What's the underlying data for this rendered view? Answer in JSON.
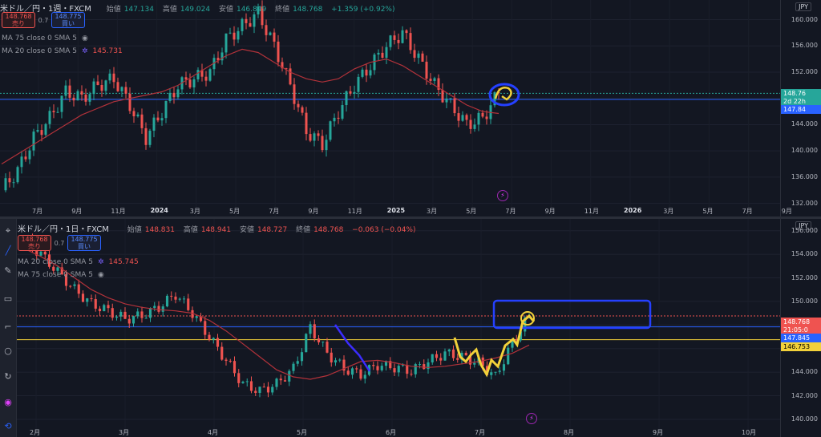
{
  "top": {
    "symbol": "米ドル／円・1週・FXCM",
    "ohlc": [
      {
        "label": "始値",
        "value": "147.134"
      },
      {
        "label": "高値",
        "value": "149.024"
      },
      {
        "label": "安値",
        "value": "146.849"
      },
      {
        "label": "終値",
        "value": "148.768"
      }
    ],
    "change": "+1.359 (+0.92%)",
    "sell_price": "148.768",
    "sell_label": "売り",
    "spread": "0.7",
    "buy_price": "148.775",
    "buy_label": "買い",
    "indicators": [
      {
        "text": "MA 75 close 0 SMA 5",
        "value": ""
      },
      {
        "text": "MA 20 close 0 SMA 5",
        "value": "145.731"
      }
    ],
    "currency": "JPY",
    "price_tag": "148.76",
    "countdown": "2d 22h",
    "blue_tag": "147.84",
    "x_labels": [
      {
        "t": "7月",
        "bold": false
      },
      {
        "t": "9月",
        "bold": false
      },
      {
        "t": "11月",
        "bold": false
      },
      {
        "t": "2024",
        "bold": true
      },
      {
        "t": "3月",
        "bold": false
      },
      {
        "t": "5月",
        "bold": false
      },
      {
        "t": "7月",
        "bold": false
      },
      {
        "t": "9月",
        "bold": false
      },
      {
        "t": "11月",
        "bold": false
      },
      {
        "t": "2025",
        "bold": true
      },
      {
        "t": "3月",
        "bold": false
      },
      {
        "t": "5月",
        "bold": false
      },
      {
        "t": "7月",
        "bold": false
      },
      {
        "t": "9月",
        "bold": false
      },
      {
        "t": "11月",
        "bold": false
      },
      {
        "t": "2026",
        "bold": true
      },
      {
        "t": "3月",
        "bold": false
      },
      {
        "t": "5月",
        "bold": false
      },
      {
        "t": "7月",
        "bold": false
      },
      {
        "t": "9月",
        "bold": false
      }
    ]
  },
  "bottom": {
    "symbol": "米ドル／円・1日・FXCM",
    "ohlc": [
      {
        "label": "始値",
        "value": "148.831"
      },
      {
        "label": "高値",
        "value": "148.941"
      },
      {
        "label": "安値",
        "value": "148.727"
      },
      {
        "label": "終値",
        "value": "148.768"
      }
    ],
    "change": "−0.063 (−0.04%)",
    "sell_price": "148.768",
    "sell_label": "売り",
    "spread": "0.7",
    "buy_price": "148.775",
    "buy_label": "買い",
    "indicators": [
      {
        "text": "MA 20 close 0 SMA 5",
        "value": "145.745"
      },
      {
        "text": "MA 75 close 0 SMA 5",
        "value": ""
      }
    ],
    "currency": "JPY",
    "tags": [
      {
        "text": "148.768",
        "color": "#ef5350"
      },
      {
        "text": "21:05:0",
        "color": "#ef5350"
      },
      {
        "text": "147.845",
        "color": "#2962ff"
      },
      {
        "text": "146.753",
        "color": "#f2d13a"
      }
    ],
    "x_labels": [
      {
        "t": "2月",
        "bold": false
      },
      {
        "t": "3月",
        "bold": false
      },
      {
        "t": "4月",
        "bold": false
      },
      {
        "t": "5月",
        "bold": false
      },
      {
        "t": "6月",
        "bold": false
      },
      {
        "t": "7月",
        "bold": false
      },
      {
        "t": "8月",
        "bold": false
      },
      {
        "t": "9月",
        "bold": false
      },
      {
        "t": "10月",
        "bold": false
      }
    ]
  },
  "chart_data": [
    {
      "type": "candlestick",
      "title": "米ドル／円・1週・FXCM",
      "ylim": [
        130,
        163
      ],
      "yticks": [
        132,
        136,
        140,
        144,
        148,
        152,
        156,
        160
      ],
      "tick_labels": [
        "132.000",
        "136.000",
        "140.000",
        "144.000",
        "148.000",
        "152.000",
        "156.000",
        "160.000"
      ],
      "x_period": [
        "2023-07",
        "2025-07"
      ],
      "ma20": [
        138,
        139.5,
        141,
        142.5,
        144,
        145.5,
        146.5,
        147.5,
        148,
        148.5,
        149,
        150,
        151.5,
        153,
        154.5,
        155.5,
        155,
        153.5,
        152,
        151,
        150.5,
        151,
        152.5,
        153.5,
        154,
        153,
        151.5,
        150,
        148.5,
        147,
        146,
        145.7
      ],
      "close": [
        134,
        137,
        142,
        145,
        149,
        148,
        150,
        151,
        147,
        142,
        146,
        150,
        151,
        152,
        157,
        159,
        161,
        156,
        150,
        143,
        141,
        146,
        150,
        153,
        156,
        158,
        154,
        150,
        147,
        144,
        145,
        148.8
      ]
    },
    {
      "type": "candlestick",
      "title": "米ドル／円・1日・FXCM",
      "ylim": [
        138.5,
        157
      ],
      "yticks": [
        140,
        142,
        144,
        146,
        148,
        150,
        152,
        154,
        156
      ],
      "tick_labels": [
        "140.000",
        "142.000",
        "144.000",
        "146.000",
        "148.000",
        "150.000",
        "152.000",
        "154.000",
        "156.000"
      ],
      "x_period": [
        "2025-02",
        "2025-07"
      ],
      "ma20": [
        154.5,
        153.8,
        153,
        152,
        151,
        150.3,
        149.8,
        149.5,
        149.3,
        149.2,
        149,
        148.4,
        147.5,
        146.4,
        145.3,
        144.2,
        143.6,
        143.4,
        143.7,
        144.3,
        144.9,
        145,
        144.8,
        144.5,
        144.4,
        144.5,
        144.7,
        144.9,
        145.2,
        145.6,
        146.3
      ],
      "close": [
        155.2,
        154,
        152.5,
        151,
        149.8,
        149.2,
        148.5,
        148.8,
        149.5,
        150.6,
        149,
        147,
        145,
        143,
        142.4,
        143,
        144.3,
        147.8,
        145.6,
        144.3,
        143.8,
        144.6,
        144.4,
        144.1,
        144.9,
        145.6,
        145.3,
        144.8,
        143.6,
        146.5,
        148.8
      ]
    }
  ]
}
